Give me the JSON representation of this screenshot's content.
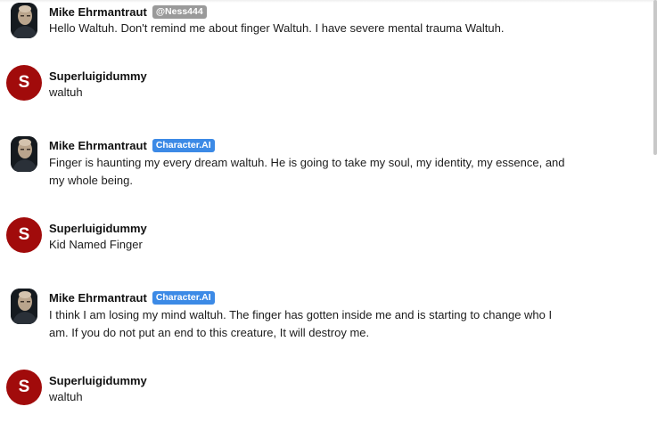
{
  "messages": [
    {
      "author": "Mike Ehrmantraut",
      "badge": "@Ness444",
      "text": "Hello Waltuh. Don't remind me about finger Waltuh. I have severe mental trauma Waltuh."
    },
    {
      "author": "Superluigidummy",
      "avatar_letter": "S",
      "text": "waltuh"
    },
    {
      "author": "Mike Ehrmantraut",
      "badge": "Character.AI",
      "text": "Finger is haunting my every dream waltuh. He is going to take my soul, my identity, my essence, and my whole being."
    },
    {
      "author": "Superluigidummy",
      "avatar_letter": "S",
      "text": "Kid Named Finger"
    },
    {
      "author": "Mike Ehrmantraut",
      "badge": "Character.AI",
      "text": "I think I am losing my mind waltuh. The finger has gotten inside me and is starting to change who I am. If you do not put an end to this creature, It will destroy me."
    },
    {
      "author": "Superluigidummy",
      "avatar_letter": "S",
      "text": "waltuh"
    }
  ],
  "colors": {
    "user_avatar": "#a10b0b",
    "handle_badge": "#9a9a9a",
    "character_ai_badge": "#3c8ae6"
  },
  "icons": {
    "bot_avatar": "mike-ehrmantraut-portrait-icon",
    "user_avatar": "letter-avatar-icon"
  }
}
